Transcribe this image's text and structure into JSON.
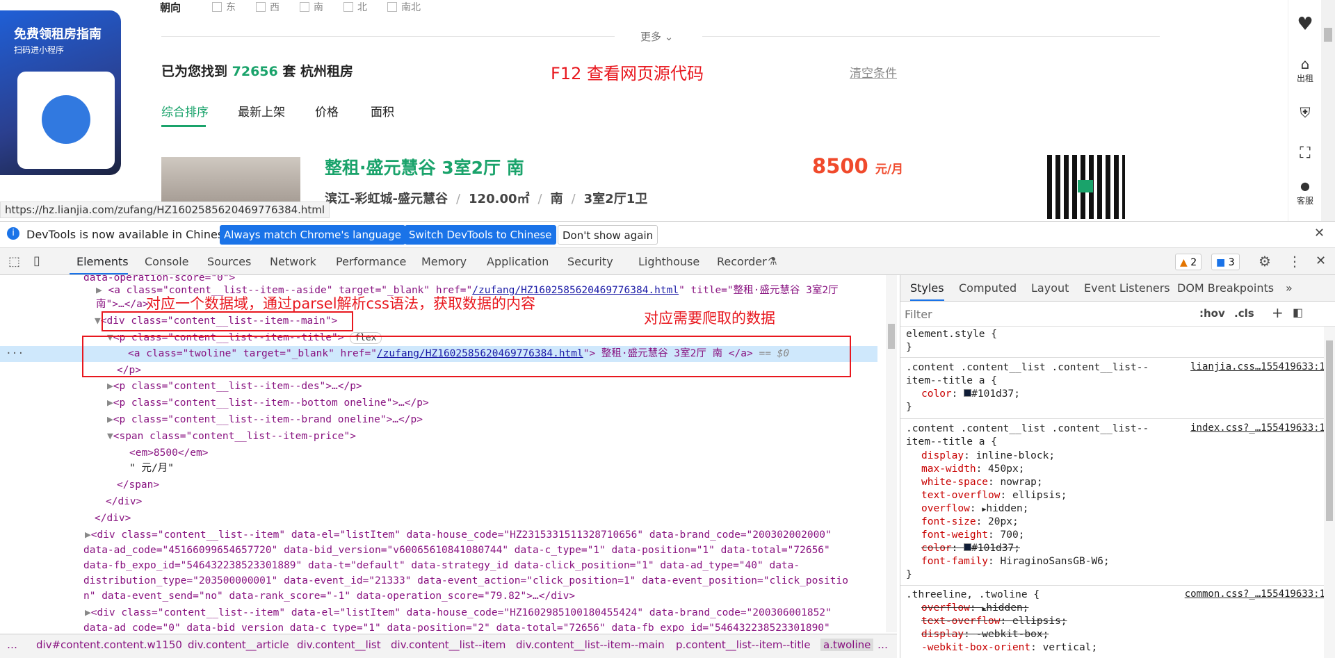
{
  "ad": {
    "title": "免费领租房指南",
    "subtitle": "扫码进小程序"
  },
  "filters": {
    "orientation_label": "朝向",
    "options": [
      "东",
      "西",
      "南",
      "北",
      "南北"
    ],
    "more": "更多"
  },
  "results": {
    "prefix": "已为您找到",
    "count": "72656",
    "suffix": "套 杭州租房",
    "clear": "清空条件"
  },
  "annotation_f12": "F12 查看网页源代码",
  "sort_tabs": [
    "综合排序",
    "最新上架",
    "价格",
    "面积"
  ],
  "listing": {
    "title": "整租·盛元慧谷 3室2厅 南",
    "district": "滨江-彩虹城-盛元慧谷",
    "area": "120.00㎡",
    "direction": "南",
    "layout": "3室2厅1卫",
    "price": "8500",
    "price_unit": "元/月"
  },
  "right_bar": {
    "rent_out": "出租",
    "service": "客服"
  },
  "status_url": "https://hz.lianjia.com/zufang/HZ1602585620469776384.html",
  "banner": {
    "text": "DevTools is now available in Chinese!",
    "btn1": "Always match Chrome's language",
    "btn2": "Switch DevTools to Chinese",
    "btn3": "Don't show again"
  },
  "devtools_tabs": [
    "Elements",
    "Console",
    "Sources",
    "Network",
    "Performance",
    "Memory",
    "Application",
    "Security",
    "Lighthouse",
    "Recorder"
  ],
  "badges": {
    "warnings": "2",
    "messages": "3"
  },
  "annotations": {
    "box1": "对应一个数据域，通过parsel解析css语法，获取数据的内容",
    "box2": "对应需要爬取的数据"
  },
  "dom": {
    "l0": "data-operation-score=\"0\">",
    "l1a": "<a class=\"content__list--item--aside\" target=\"_blank\" href=\"",
    "l1href": "/zufang/HZ1602585620469776384.html",
    "l1b": "\" title=\"整租·盛元慧谷 3室2厅",
    "l1c": "南\">…</a>",
    "l2": "<div class=\"content__list--item--main\">",
    "l3": "<p class=\"content__list--item--title\">",
    "l3badge": "flex",
    "l4a": "<a class=\"twoline\" target=\"_blank\" href=\"",
    "l4href": "/zufang/HZ1602585620469776384.html",
    "l4b": "\"> 整租·盛元慧谷 3室2厅 南 </a>",
    "l4eq": "== $0",
    "l5": "</p>",
    "l6": "<p class=\"content__list--item--des\">…</p>",
    "l7": "<p class=\"content__list--item--bottom oneline\">…</p>",
    "l8": "<p class=\"content__list--item--brand oneline\">…</p>",
    "l9": "<span class=\"content__list--item-price\">",
    "l10": "<em>8500</em>",
    "l11": "\" 元/月\"",
    "l12": "</span>",
    "l13": "</div>",
    "l14": "</div>",
    "l15": "<div class=\"content__list--item\" data-el=\"listItem\" data-house_code=\"HZ2315331511328710656\" data-brand_code=\"200302002000\"",
    "l16": "data-ad_code=\"45166099654657720\" data-bid_version=\"v60065610841080744\" data-c_type=\"1\" data-position=\"1\" data-total=\"72656\"",
    "l17": "data-fb_expo_id=\"546432238523301889\" data-t=\"default\" data-strategy_id data-click_position=\"1\" data-ad_type=\"40\" data-",
    "l18": "distribution_type=\"203500000001\" data-event_id=\"21333\" data-event_action=\"click_position=1\" data-event_position=\"click_positio",
    "l19": "n\" data-event_send=\"no\" data-rank_score=\"-1\" data-operation_score=\"79.82\">…</div>",
    "l20": "<div class=\"content__list--item\" data-el=\"listItem\" data-house_code=\"HZ1602985100180455424\" data-brand_code=\"200306001852\"",
    "l21": "data-ad_code=\"0\" data-bid_version data-c_type=\"1\" data-position=\"2\" data-total=\"72656\" data-fb_expo_id=\"546432238523301890\""
  },
  "breadcrumb": [
    "…",
    "div#content.content.w1150",
    "div.content__article",
    "div.content__list",
    "div.content__list--item",
    "div.content__list--item--main",
    "p.content__list--item--title",
    "a.twoline",
    "…"
  ],
  "styles": {
    "tabs": [
      "Styles",
      "Computed",
      "Layout",
      "Event Listeners",
      "DOM Breakpoints"
    ],
    "filter_placeholder": "Filter",
    "hov": ":hov",
    "cls": ".cls",
    "lines": {
      "s1": "element.style {",
      "s2": "}",
      "s3": ".content .content__list .content__list--",
      "s3src": "lianjia.css…155419633:1",
      "s4": "item--title a {",
      "s5p": "color",
      "s5v": "#101d37;",
      "s6": "}",
      "s7": ".content .content__list .content__list--",
      "s7src": "index.css?_…155419633:1",
      "s8": "item--title a {",
      "d1p": "display",
      "d1v": "inline-block;",
      "d2p": "max-width",
      "d2v": "450px;",
      "d3p": "white-space",
      "d3v": "nowrap;",
      "d4p": "text-overflow",
      "d4v": "ellipsis;",
      "d5p": "overflow",
      "d5v": "hidden;",
      "d6p": "font-size",
      "d6v": "20px;",
      "d7p": "font-weight",
      "d7v": "700;",
      "d8p": "color",
      "d8v": "#101d37;",
      "d9p": "font-family",
      "d9v": "HiraginoSansGB-W6;",
      "s9": "}",
      "s10": ".threeline, .twoline {",
      "s10src": "common.css?_…155419633:1",
      "e1p": "overflow",
      "e1v": "hidden;",
      "e2p": "text-overflow",
      "e2v": "ellipsis;",
      "e3p": "display",
      "e3v": "-webkit-box;",
      "e4p": "-webkit-box-orient",
      "e4v": "vertical;"
    }
  },
  "colors": {
    "accent_green": "#1aa36b",
    "price_red": "#f04a2c",
    "annotation_red": "#e8171e",
    "devtools_blue": "#1a73e8"
  }
}
